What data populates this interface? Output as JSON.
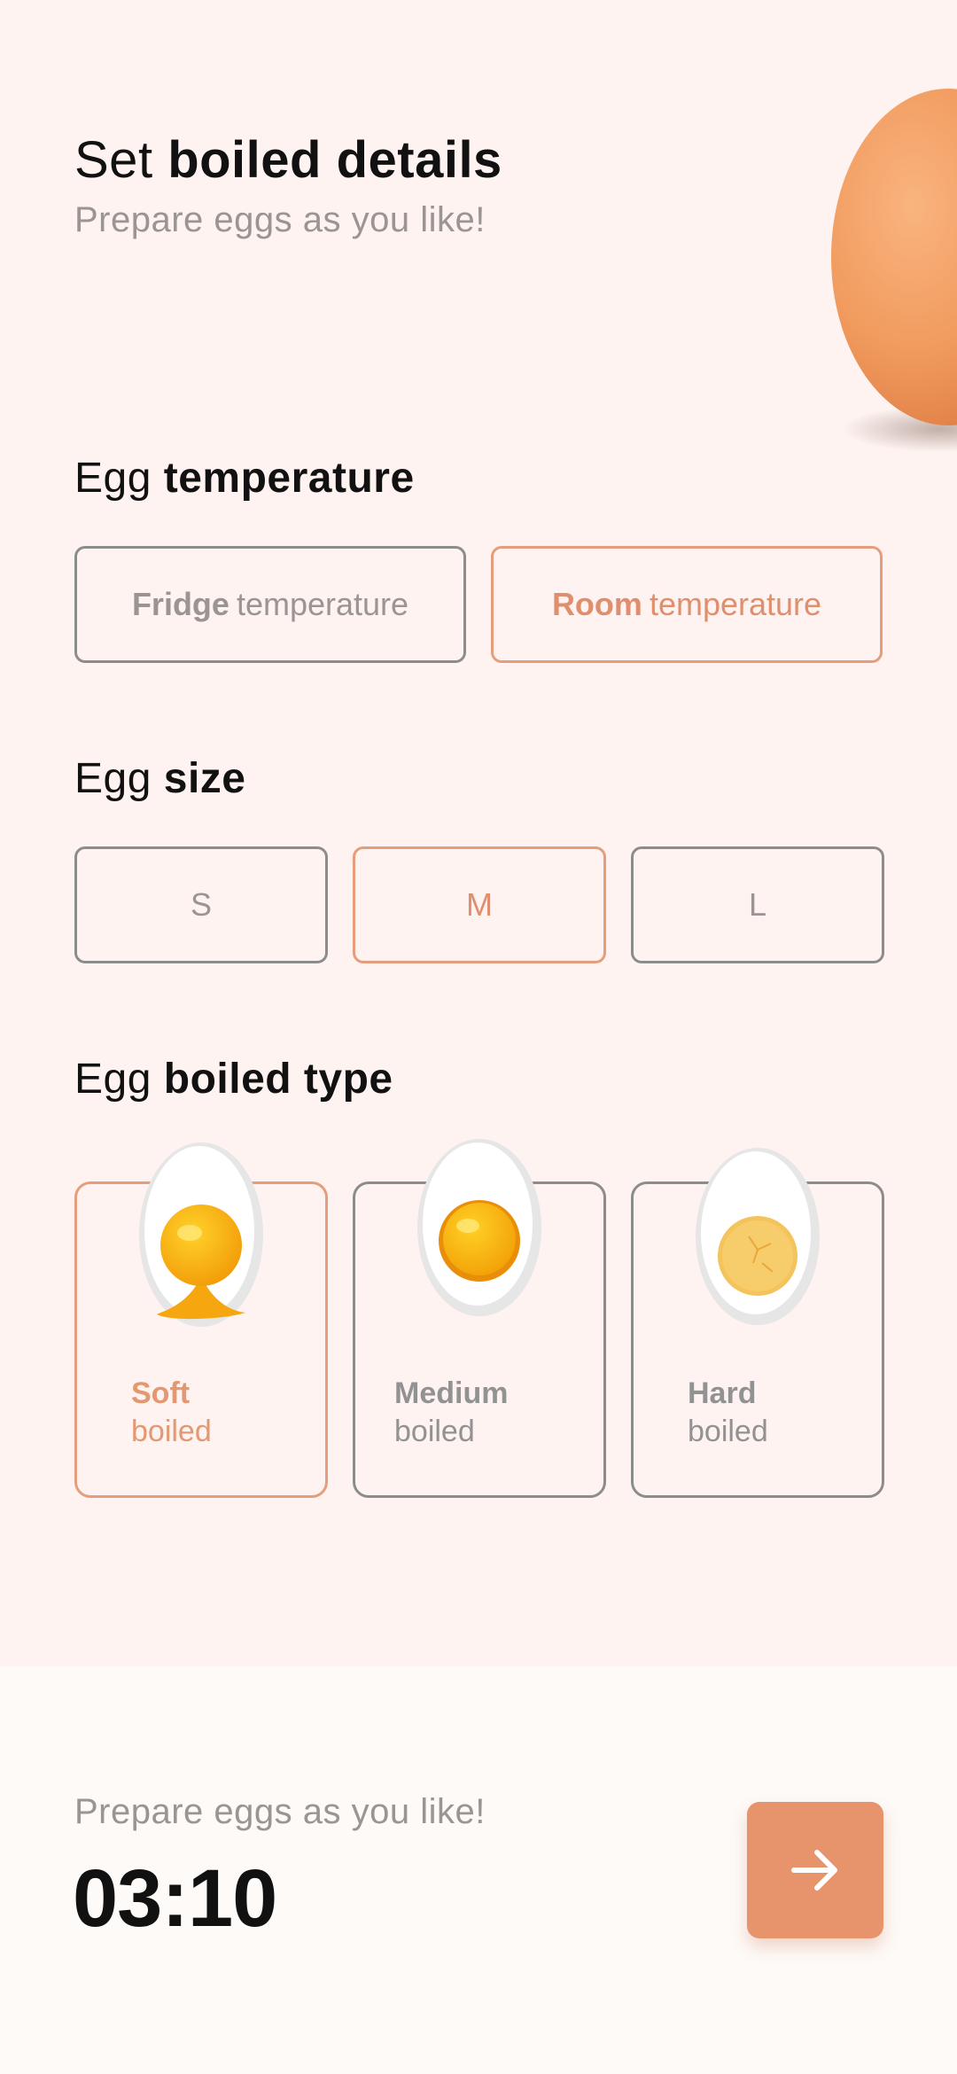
{
  "header": {
    "title_prefix": "Set",
    "title_bold": "boiled details",
    "subtitle": "Prepare eggs as you like!"
  },
  "temperature": {
    "title_prefix": "Egg",
    "title_bold": "temperature",
    "options": [
      {
        "bold": "Fridge",
        "rest": "temperature",
        "selected": false
      },
      {
        "bold": "Room",
        "rest": "temperature",
        "selected": true
      }
    ]
  },
  "size": {
    "title_prefix": "Egg",
    "title_bold": "size",
    "options": [
      {
        "label": "S",
        "selected": false
      },
      {
        "label": "M",
        "selected": true
      },
      {
        "label": "L",
        "selected": false
      }
    ]
  },
  "boiled_type": {
    "title_prefix": "Egg",
    "title_bold": "boiled type",
    "options": [
      {
        "bold": "Soft",
        "rest": "boiled",
        "selected": true
      },
      {
        "bold": "Medium",
        "rest": "boiled",
        "selected": false
      },
      {
        "bold": "Hard",
        "rest": "boiled",
        "selected": false
      }
    ]
  },
  "footer": {
    "subtitle": "Prepare eggs as you like!",
    "timer": "03:10"
  },
  "icons": {
    "next": "arrow-right-icon"
  },
  "colors": {
    "accent": "#e7946c",
    "accent_text": "#e08f6e",
    "background": "#fef3f0"
  }
}
